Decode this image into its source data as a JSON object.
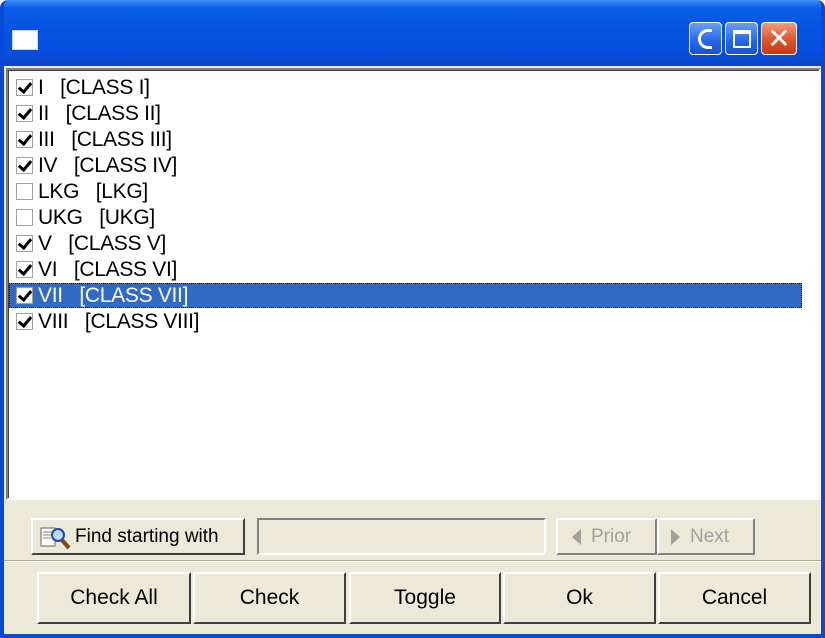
{
  "window": {
    "title": ""
  },
  "list": {
    "items": [
      {
        "label": "I   [CLASS I]",
        "checked": true,
        "selected": false
      },
      {
        "label": "II   [CLASS II]",
        "checked": true,
        "selected": false
      },
      {
        "label": "III   [CLASS III]",
        "checked": true,
        "selected": false
      },
      {
        "label": "IV   [CLASS IV]",
        "checked": true,
        "selected": false
      },
      {
        "label": "LKG   [LKG]",
        "checked": false,
        "selected": false
      },
      {
        "label": "UKG   [UKG]",
        "checked": false,
        "selected": false
      },
      {
        "label": "V   [CLASS V]",
        "checked": true,
        "selected": false
      },
      {
        "label": "VI   [CLASS VI]",
        "checked": true,
        "selected": false
      },
      {
        "label": "VII   [CLASS VII]",
        "checked": true,
        "selected": true
      },
      {
        "label": "VIII   [CLASS VIII]",
        "checked": true,
        "selected": false
      }
    ]
  },
  "find": {
    "button_label": "Find starting with",
    "input_value": "",
    "prior_label": "Prior",
    "next_label": "Next",
    "icon": "find-icon"
  },
  "buttons": {
    "check_all": "Check All",
    "check": "Check",
    "toggle": "Toggle",
    "ok": "Ok",
    "cancel": "Cancel"
  },
  "colors": {
    "titlebar": "#0553e0",
    "selection": "#316ac5",
    "face": "#ece9d8"
  }
}
